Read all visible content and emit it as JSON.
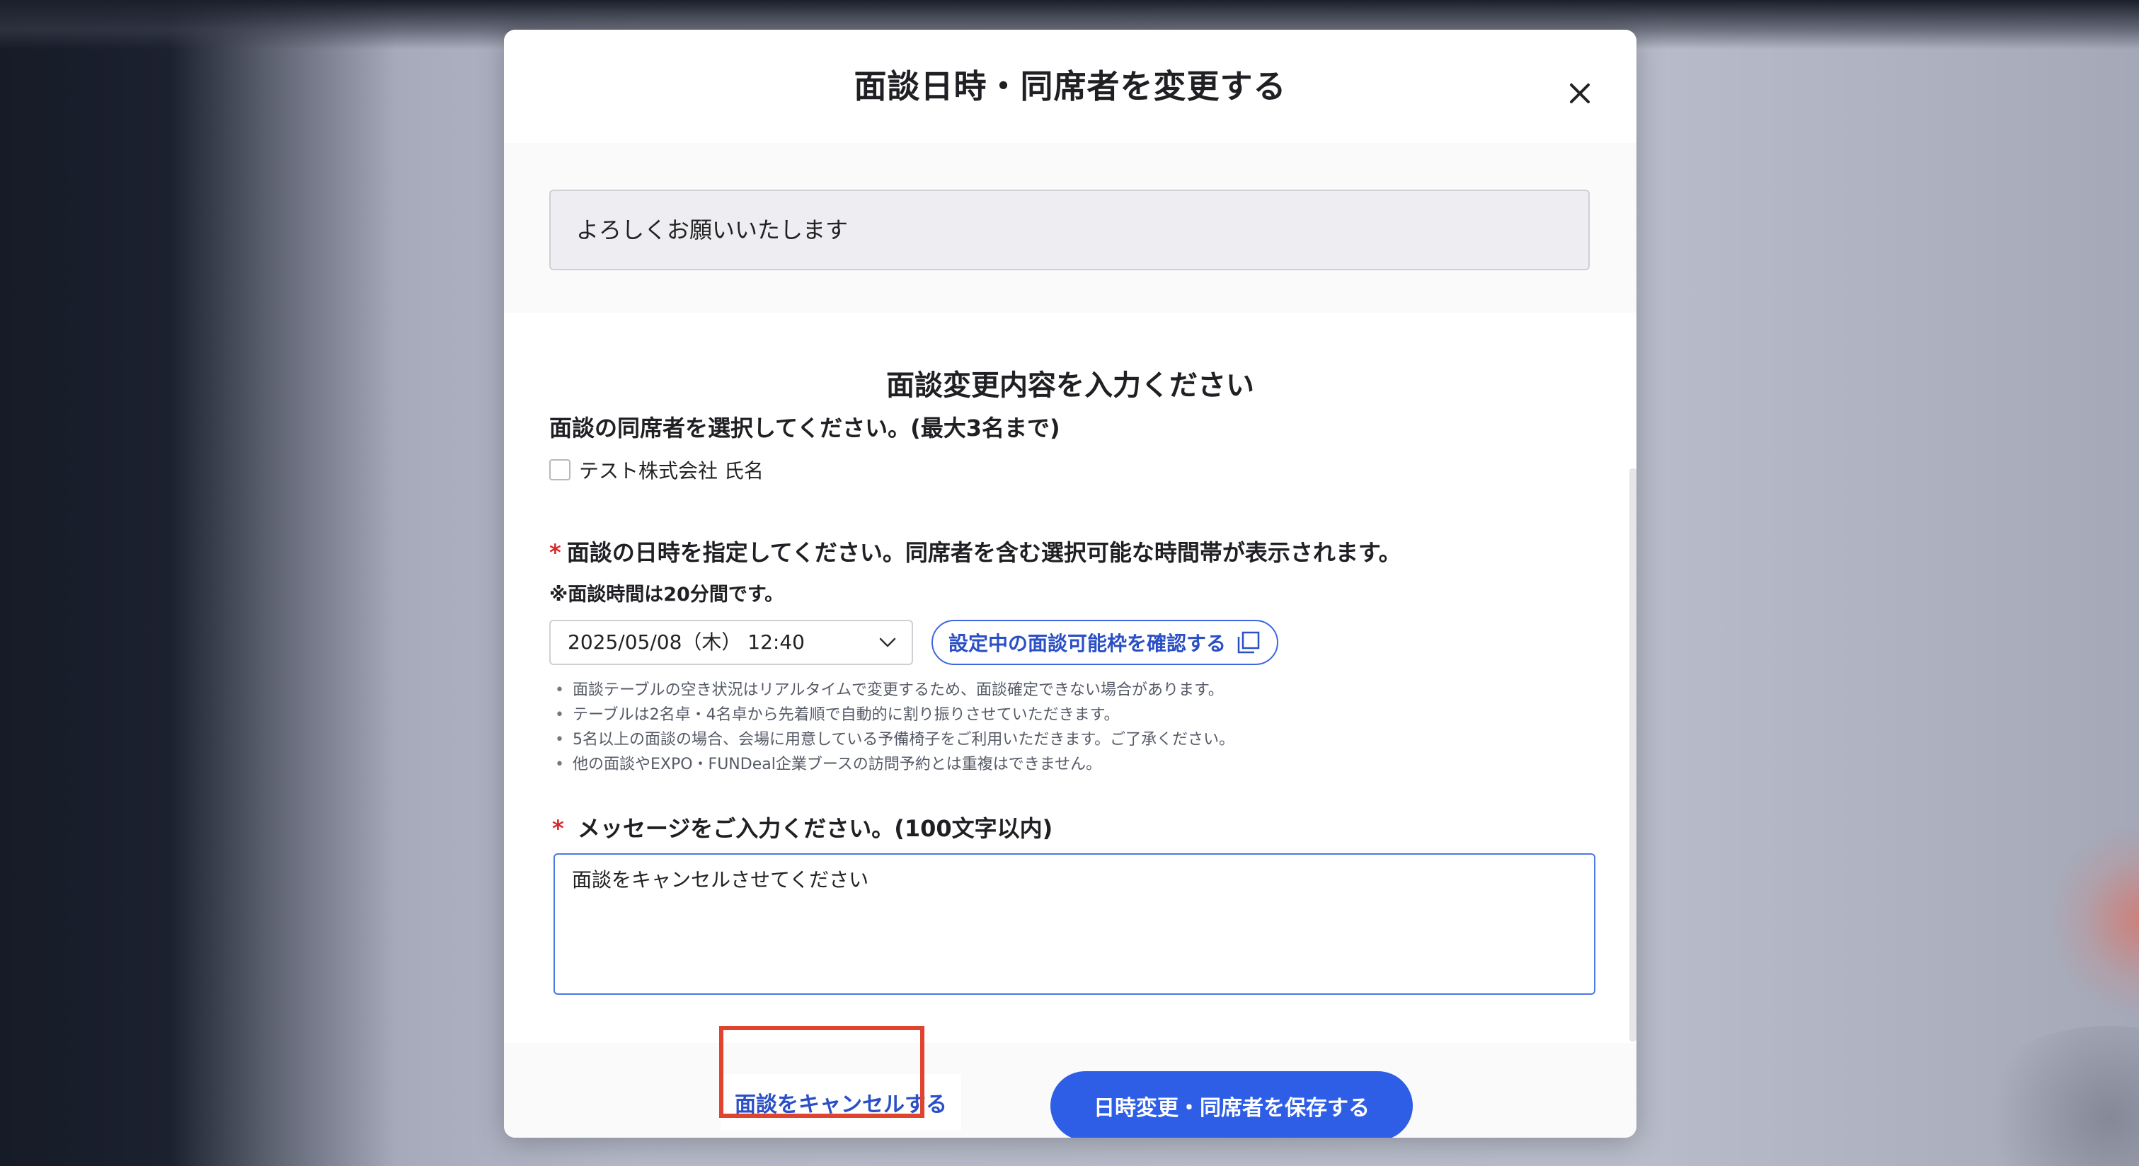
{
  "modal": {
    "title": "面談日時・同席者を変更する",
    "close_icon": "close-icon"
  },
  "previous_message": "よろしくお願いいたします",
  "form": {
    "section_title": "面談変更内容を入力ください",
    "attendees": {
      "label": "面談の同席者を選択してください。(最大3名まで)",
      "options": [
        {
          "label": "テスト株式会社 氏名",
          "checked": false
        }
      ]
    },
    "datetime": {
      "required_mark": "*",
      "label": "面談の日時を指定してください。同席者を含む選択可能な時間帯が表示されます。",
      "note": "※面談時間は20分間です。",
      "selected_value": "2025/05/08（木） 12:40",
      "slot_button_label": "設定中の面談可能枠を確認する",
      "bullets": [
        "面談テーブルの空き状況はリアルタイムで変更するため、面談確定できない場合があります。",
        "テーブルは2名卓・4名卓から先着順で自動的に割り振りさせていただきます。",
        "5名以上の面談の場合、会場に用意している予備椅子をご利用いただきます。ご了承ください。",
        "他の面談やEXPO・FUNDeal企業ブースの訪問予約とは重複はできません。"
      ]
    },
    "message": {
      "required_mark": "*",
      "label": "メッセージをご入力ください。(100文字以内)",
      "value": "面談をキャンセルさせてください"
    }
  },
  "footer": {
    "cancel_label": "面談をキャンセルする",
    "save_label": "日時変更・同席者を保存する"
  },
  "colors": {
    "accent": "#2f5ee6",
    "link": "#2b4fc6",
    "required": "#d62a2a",
    "highlight": "#e0442f"
  }
}
